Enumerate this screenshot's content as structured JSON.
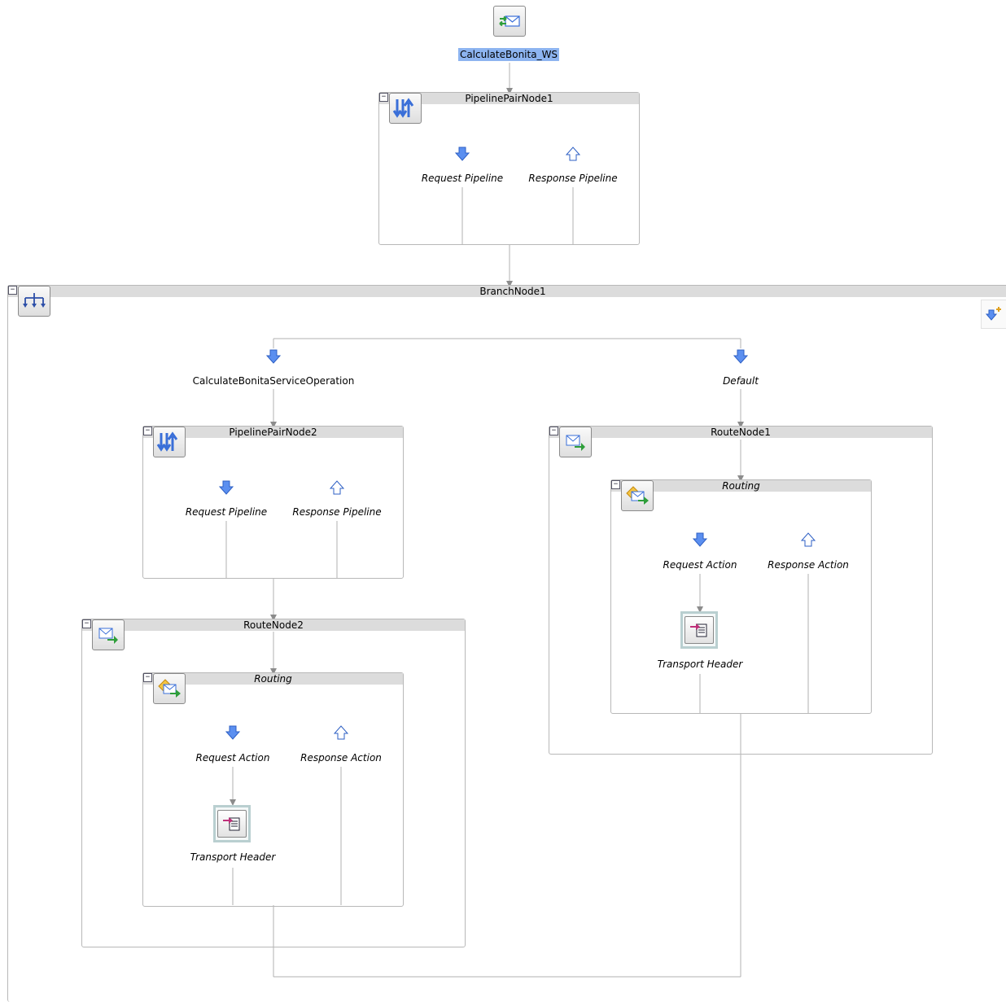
{
  "proxy": {
    "name": "CalculateBonita_WS",
    "icon": "proxy-service-icon"
  },
  "pipeline_pair_1": {
    "title": "PipelinePairNode1",
    "request_label": "Request Pipeline",
    "response_label": "Response Pipeline"
  },
  "branch_node": {
    "title": "BranchNode1",
    "branches": [
      {
        "label": "CalculateBonitaServiceOperation"
      },
      {
        "label": "Default"
      }
    ]
  },
  "pipeline_pair_2": {
    "title": "PipelinePairNode2",
    "request_label": "Request Pipeline",
    "response_label": "Response Pipeline"
  },
  "route_node_2": {
    "title": "RouteNode2",
    "routing": {
      "title": "Routing",
      "request_label": "Request Action",
      "response_label": "Response Action",
      "action_label": "Transport Header"
    }
  },
  "route_node_1": {
    "title": "RouteNode1",
    "routing": {
      "title": "Routing",
      "request_label": "Request Action",
      "response_label": "Response Action",
      "action_label": "Transport Header"
    }
  },
  "colors": {
    "selection": "#8db4f0",
    "header_bar": "#dcdcdc",
    "wire": "#b0b0b0",
    "arrow_blue": "#3a6fd8"
  }
}
